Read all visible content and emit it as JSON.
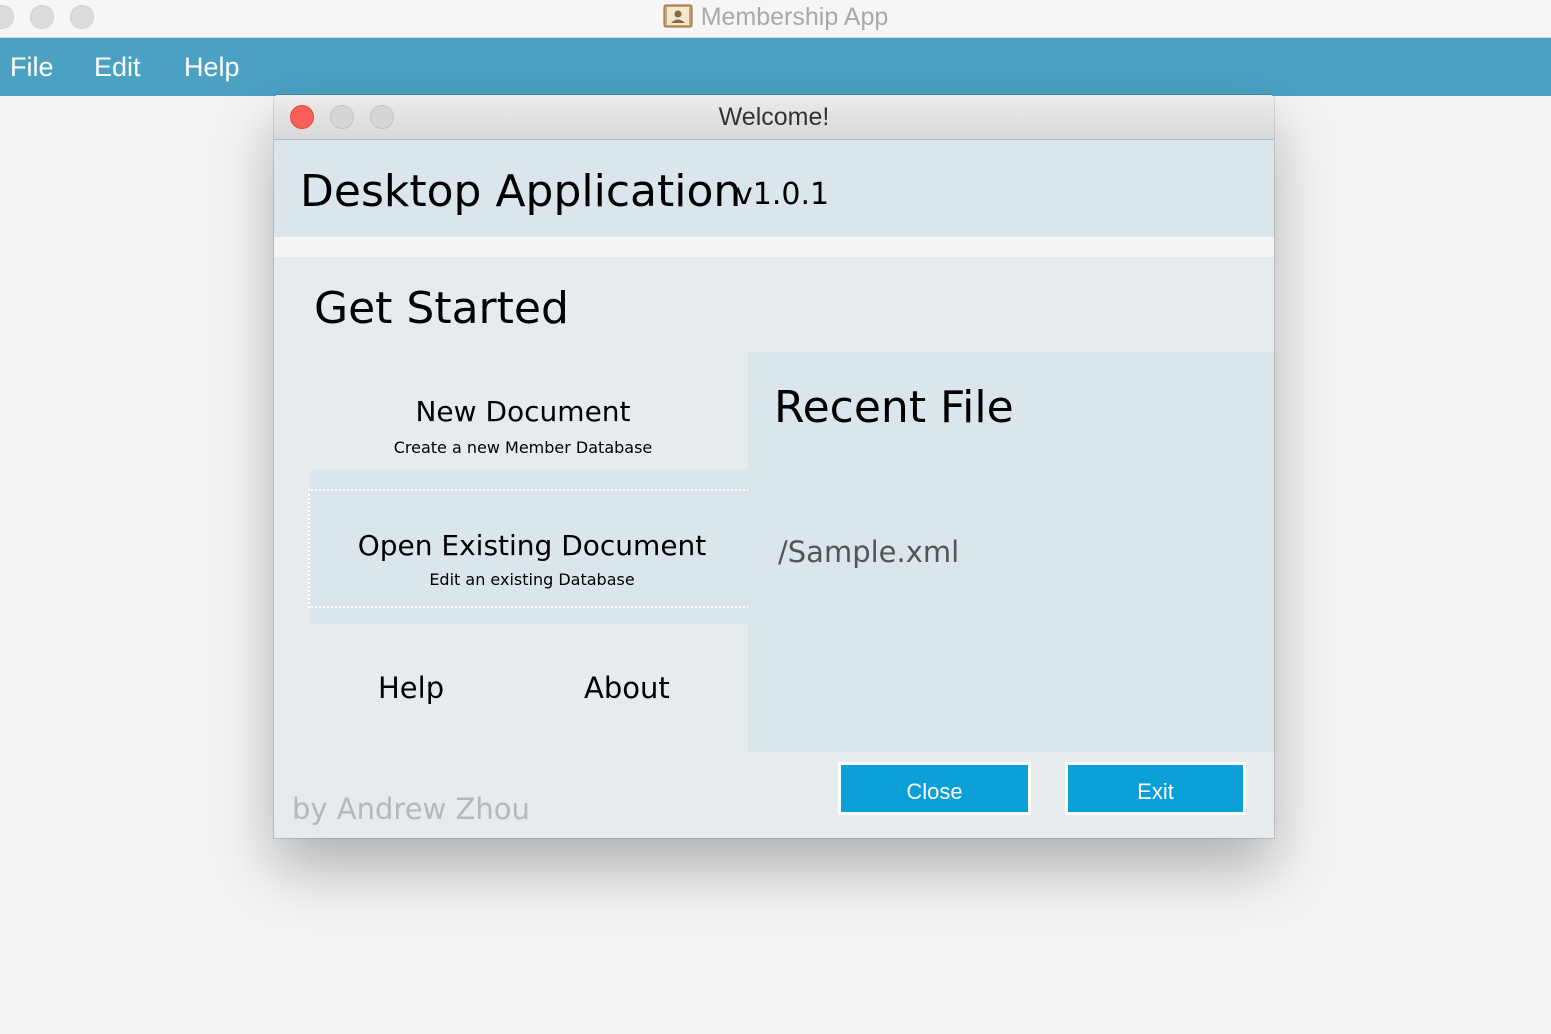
{
  "window": {
    "title": "Membership App",
    "app_icon": "contacts-book-icon"
  },
  "menubar": {
    "items": [
      {
        "label": "File"
      },
      {
        "label": "Edit"
      },
      {
        "label": "Help"
      }
    ],
    "background": "#4aa1c2"
  },
  "dialog": {
    "title": "Welcome!",
    "app_name": "Desktop Application",
    "version": "v1.0.1",
    "get_started": "Get Started",
    "options": {
      "new_document": {
        "title": "New Document",
        "subtitle": "Create a new Member Database"
      },
      "open_document": {
        "title": "Open Existing Document",
        "subtitle": "Edit an existing Database"
      }
    },
    "links": {
      "help": "Help",
      "about": "About"
    },
    "recent": {
      "title": "Recent File",
      "files": [
        "/Sample.xml"
      ]
    },
    "author": "by Andrew Zhou",
    "buttons": {
      "close": "Close",
      "exit": "Exit"
    },
    "colors": {
      "button": "#0a9fd7",
      "panel": "#dbe5ec",
      "background": "#e6ebee",
      "close_light": "#fc5f57"
    }
  }
}
